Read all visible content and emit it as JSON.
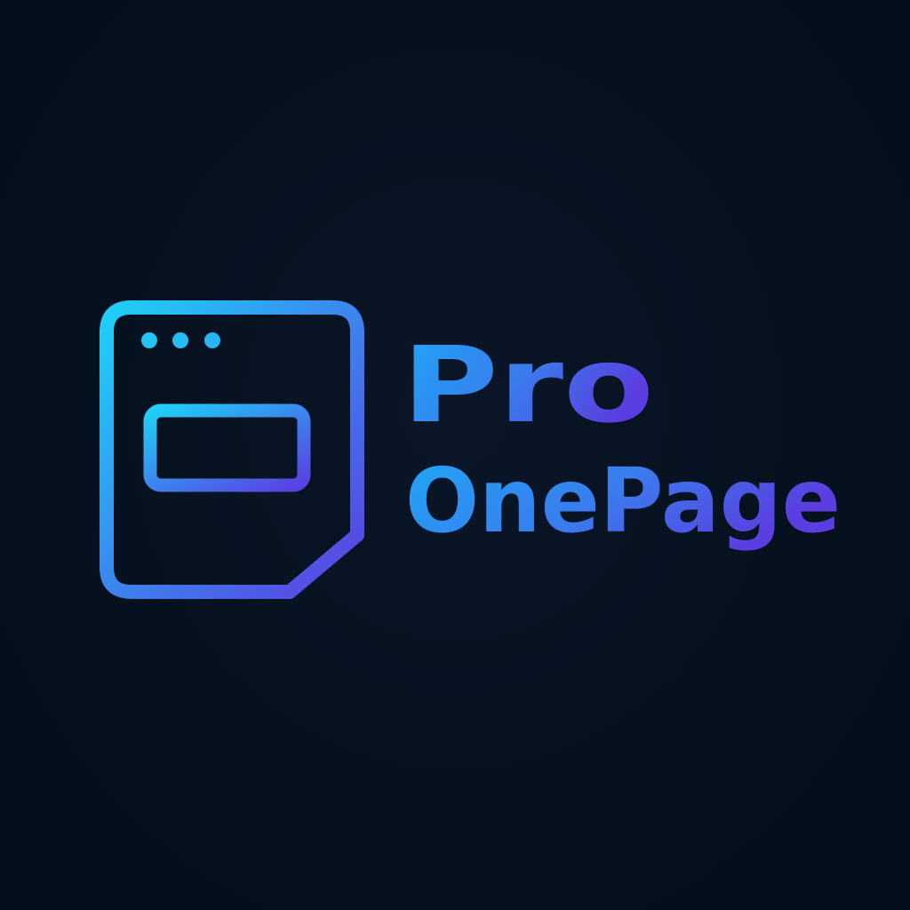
{
  "brand": {
    "name_line1": "Pro",
    "name_line2": "OnePage"
  },
  "icons": {
    "logo_mark": "browser-window-page-icon"
  },
  "colors": {
    "background": "#06111f",
    "gradient_start": "#22c8f5",
    "gradient_mid": "#3a86ee",
    "gradient_end": "#5b3ee0"
  }
}
